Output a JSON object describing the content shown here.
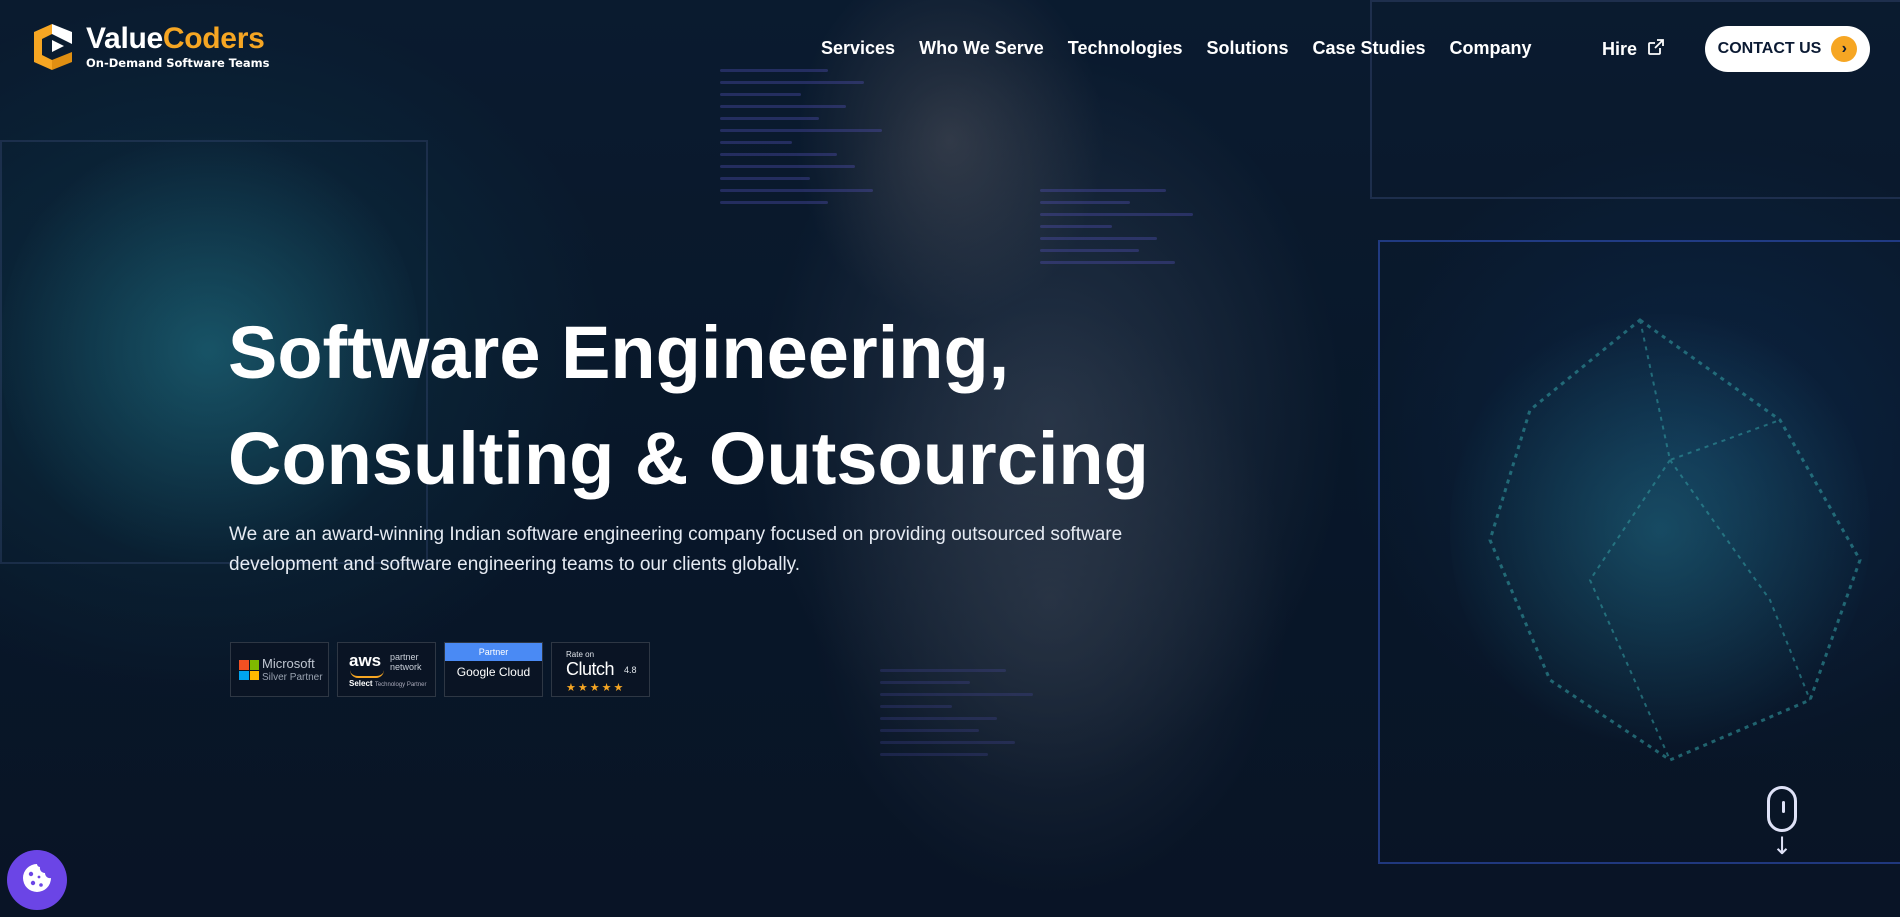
{
  "header": {
    "logo": {
      "name_part1": "Value",
      "name_part2": "Coders",
      "tagline": "On-Demand Software Teams"
    },
    "nav": [
      "Services",
      "Who We Serve",
      "Technologies",
      "Solutions",
      "Case Studies",
      "Company"
    ],
    "hire_label": "Hire",
    "contact_label": "CONTACT US"
  },
  "hero": {
    "title_line1": "Software Engineering,",
    "title_line2": "Consulting & Outsourcing",
    "description": "We are an award-winning Indian software engineering company focused on providing outsourced software development and software engineering teams to our clients globally."
  },
  "badges": {
    "microsoft": {
      "name": "Microsoft",
      "sub": "Silver Partner"
    },
    "aws": {
      "name": "aws",
      "line1": "partner",
      "line2": "network",
      "select": "Select",
      "select_sub": "Technology Partner"
    },
    "google": {
      "top": "Partner",
      "word1": "Google",
      "word2": "Cloud"
    },
    "clutch": {
      "rate": "Rate on",
      "name": "Clutch",
      "score": "4.8",
      "stars": "★★★★★"
    }
  },
  "colors": {
    "accent": "#f6a623",
    "cookie": "#6b45e6",
    "frame": "#4668ff"
  },
  "icons": {
    "hire": "external-link-icon",
    "contact": "chevron-right-icon",
    "scroll": "mouse-scroll-icon",
    "cookie": "cookie-icon"
  }
}
